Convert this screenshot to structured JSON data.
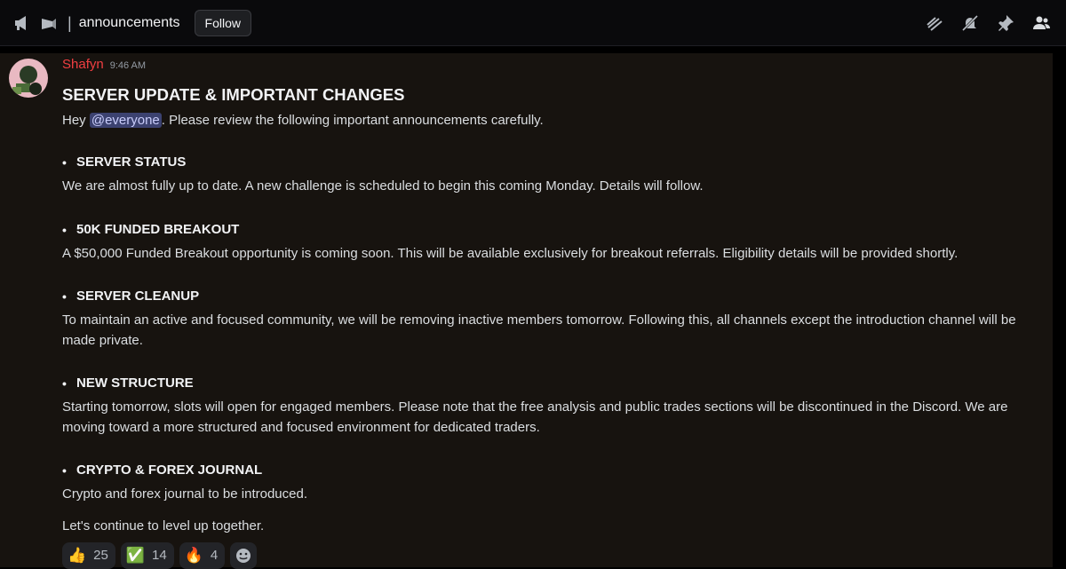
{
  "channel": {
    "name": "announcements",
    "follow_label": "Follow",
    "separator": "|"
  },
  "header_icons": [
    "threads-icon",
    "mute-icon",
    "pin-icon",
    "members-icon"
  ],
  "message": {
    "author": "Shafyn",
    "author_color": "#f23f42",
    "time": "9:46 AM",
    "title": "SERVER UPDATE & IMPORTANT CHANGES",
    "intro_prefix": "Hey ",
    "mention": "@everyone",
    "intro_suffix": ". Please review the following important announcements carefully.",
    "bullet": "•",
    "sections": [
      {
        "heading": "SERVER STATUS",
        "body": "We are almost fully up to date. A new challenge is scheduled to begin this coming Monday. Details will follow."
      },
      {
        "heading": "50K FUNDED BREAKOUT",
        "body": "A $50,000 Funded Breakout opportunity is coming soon. This will be available exclusively for breakout referrals. Eligibility details will be provided shortly."
      },
      {
        "heading": "SERVER CLEANUP",
        "body": "To maintain an active and focused community, we will be removing inactive members tomorrow. Following this, all channels except the introduction channel will be made private."
      },
      {
        "heading": "NEW STRUCTURE",
        "body": "Starting tomorrow, slots will open for engaged members. Please note that the free analysis and public trades sections will be discontinued in the Discord. We are moving toward a more structured and focused environment for dedicated traders."
      },
      {
        "heading": "CRYPTO & FOREX JOURNAL",
        "body": "Crypto and forex journal to be introduced."
      }
    ],
    "outro": "Let's continue to level up together."
  },
  "reactions": [
    {
      "emoji": "👍",
      "count": "25"
    },
    {
      "emoji": "✅",
      "count": "14"
    },
    {
      "emoji": "🔥",
      "count": "4"
    }
  ],
  "add_reaction_icon": "smiley-add-reaction-icon"
}
